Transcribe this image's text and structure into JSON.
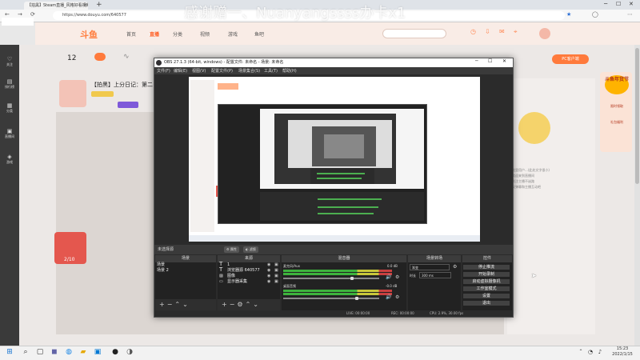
{
  "browser": {
    "tab_title": "【拍黑】Steam直播_风格好看视频",
    "url": "https://www.douyu.com/640577",
    "danmaku_overlay": "感谢赠一、Nuanyangssss办卡x1"
  },
  "douyu": {
    "logo": "斗鱼",
    "nav": [
      "首页",
      "直播",
      "分类",
      "视频",
      "游戏",
      "鱼吧"
    ],
    "nav_active_index": 1,
    "fans_count": "12",
    "stream_title": "【拍黑】上分日记：第二",
    "pc_client_label": "PC客户端",
    "gift_count": "2/10",
    "rail_items": [
      "关注",
      "排行榜",
      "分类",
      "直播间",
      "游戏"
    ],
    "chat_lines": [
      "这里用户...(此处文字很小)",
      "欢迎来到直播间",
      "关注主播不迷路",
      "发弹幕和主播互动吧"
    ],
    "promo_lines": [
      "斗鱼年货节",
      "限时领取",
      "礼包福利"
    ]
  },
  "obs": {
    "title": "OBS 27.1.3 (64-bit, windows) - 配置文件: 未命名 - 场景: 未命名",
    "menus": [
      "文件(F)",
      "编辑(E)",
      "视图(V)",
      "配置文件(P)",
      "场景集合(S)",
      "工具(T)",
      "帮助(H)"
    ],
    "scene_status": "未选择源",
    "properties_label": "属性",
    "filters_label": "滤镜",
    "docks": {
      "scenes": "场景",
      "sources": "来源",
      "mixer": "混音器",
      "transitions": "场景转场",
      "controls": "控件"
    },
    "scenes": [
      "场景",
      "场景 2"
    ],
    "sources": [
      "1",
      "浏览器源 640577",
      "图像",
      "显示器采集"
    ],
    "mixer": [
      {
        "name": "麦克风/Aux",
        "db": "0.0 dB"
      },
      {
        "name": "桌面音频",
        "db": "-0.0 dB"
      }
    ],
    "transition_type": "渐变",
    "transition_duration_label": "时长",
    "transition_duration": "300 ms",
    "controls": [
      "停止推流",
      "开始录制",
      "启动虚拟摄像机",
      "工作室模式",
      "设置",
      "退出"
    ],
    "status_bar": {
      "live": "LIVE: 00:00:00",
      "rec": "REC: 00:00:00",
      "cpu": "CPU: 2.9%, 30.00 fps"
    }
  },
  "taskbar": {
    "time": "15:23",
    "date": "2022/1/15"
  },
  "colors": {
    "accent": "#ff5d23",
    "obs_bg": "#2b2b2b",
    "meter_green": "#3db33d"
  }
}
